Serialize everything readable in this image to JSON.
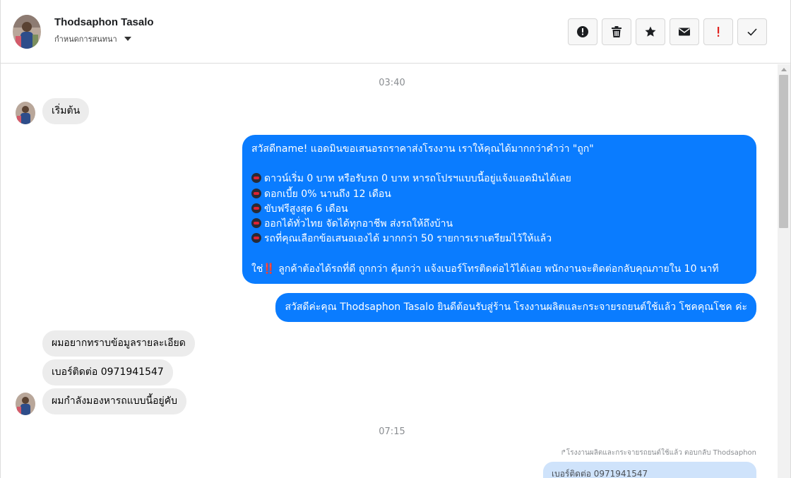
{
  "header": {
    "contact_name": "Thodsaphon Tasalo",
    "assign_label": "กำหนดการสนทนา",
    "actions": [
      {
        "name": "report-spam-button",
        "icon": "alert-circle-icon"
      },
      {
        "name": "delete-button",
        "icon": "trash-icon"
      },
      {
        "name": "star-button",
        "icon": "star-icon"
      },
      {
        "name": "mark-unread-button",
        "icon": "envelope-icon"
      },
      {
        "name": "flag-important-button",
        "icon": "exclamation-icon"
      },
      {
        "name": "mark-done-button",
        "icon": "check-icon"
      }
    ]
  },
  "conversation": {
    "time_1": "03:40",
    "msg_start": "เริ่มต้น",
    "msg_page_intro": {
      "line1": "สวัสดีname! แอดมินขอเสนอรถราคาส่งโรงงาน เราให้คุณได้มากกว่าคำว่า \"ถูก\"",
      "item1": "ดาวน์เริ่ม 0 บาท หรือรับรถ 0 บาท หารถโปรฯแบบนี้อยู่แจ้งแอดมินได้เลย",
      "item2": "ดอกเบี้ย 0% นานถึง 12 เดือน",
      "item3": "ขับฟรีสูงสุด 6 เดือน",
      "item4": "ออกได้ทั่วไทย จัดได้ทุกอาชีพ ส่งรถให้ถึงบ้าน",
      "item5": "รถที่คุณเลือกข้อเสนอเองได้ มากกว่า 50 รายการเราเตรียมไว้ให้แล้ว",
      "closing_pre": "ใช่",
      "closing_mark": "‼️",
      "closing_post": "ลูกค้าต้องได้รถที่ดี ถูกกว่า คุ้มกว่า แจ้งเบอร์โทรติดต่อไว้ได้เลย พนักงานจะติดต่อกลับคุณภายใน 10 นาที"
    },
    "msg_page_welcome": "สวัสดีค่ะคุณ Thodsaphon Tasalo ยินดีต้อนรับสู่ร้าน โรงงานผลิตและกระจายรถยนต์ใช้แล้ว โชคคุณโชค ค่ะ",
    "msg_user_1": "ผมอยากทราบข้อมูลรายละเอียด",
    "msg_user_2": "เบอร์ติดต่อ 0971941547",
    "msg_user_3": "ผมกำลังมองหารถแบบนี้อยู่คับ",
    "time_2": "07:15",
    "reply_note": "โรงงานผลิตและกระจายรถยนต์ใช้แล้ว ตอบกลับ Thodsaphon",
    "quoted_text": "เบอร์ติดต่อ 0971941547"
  },
  "colors": {
    "outgoing_bubble": "#0a7cff",
    "incoming_bubble": "#ececec",
    "important_flag": "#e0201c"
  }
}
